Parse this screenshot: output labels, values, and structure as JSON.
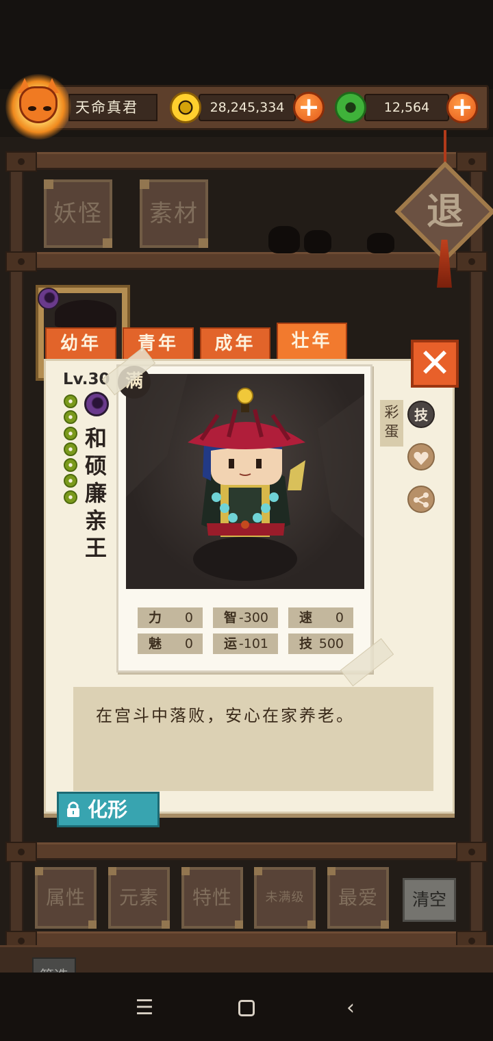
{
  "player": {
    "name": "天命真君",
    "coins": "28,245,334",
    "jade": "12,564",
    "avatar_icon": "fox-mask-icon"
  },
  "top_categories": [
    {
      "label": "妖怪"
    },
    {
      "label": "素材"
    }
  ],
  "exit_label": "退",
  "age_tabs": [
    {
      "label": "幼年",
      "active": false
    },
    {
      "label": "青年",
      "active": false
    },
    {
      "label": "成年",
      "active": false
    },
    {
      "label": "壮年",
      "active": true
    }
  ],
  "character": {
    "level": "Lv.30",
    "max_badge": "满",
    "star_count": 7,
    "name_chars": [
      "和",
      "硕",
      "廉",
      "亲",
      "王"
    ],
    "element": "dark-element-icon",
    "stats": [
      {
        "key": "力",
        "value": "0"
      },
      {
        "key": "智",
        "value": "-300"
      },
      {
        "key": "速",
        "value": "0"
      },
      {
        "key": "魅",
        "value": "0"
      },
      {
        "key": "运",
        "value": "-101"
      },
      {
        "key": "技",
        "value": "500"
      }
    ],
    "description": "在宫斗中落败，安心在家养老。"
  },
  "side_actions": {
    "easter_egg_label": "彩蛋",
    "skill_label": "技",
    "favorite_icon": "heart-icon",
    "share_icon": "share-icon"
  },
  "transform_label": "化形",
  "close_icon": "close-icon",
  "filters": [
    {
      "label": "属性"
    },
    {
      "label": "元素"
    },
    {
      "label": "特性"
    },
    {
      "label": "未满级"
    },
    {
      "label": "最爱"
    }
  ],
  "clear_label": "清空",
  "screen_label": "筛选",
  "colors": {
    "accent_orange": "#e2642a",
    "card_bg": "#f5efdd",
    "teal_button": "#38a4b0",
    "wood": "#5d3f2b"
  }
}
